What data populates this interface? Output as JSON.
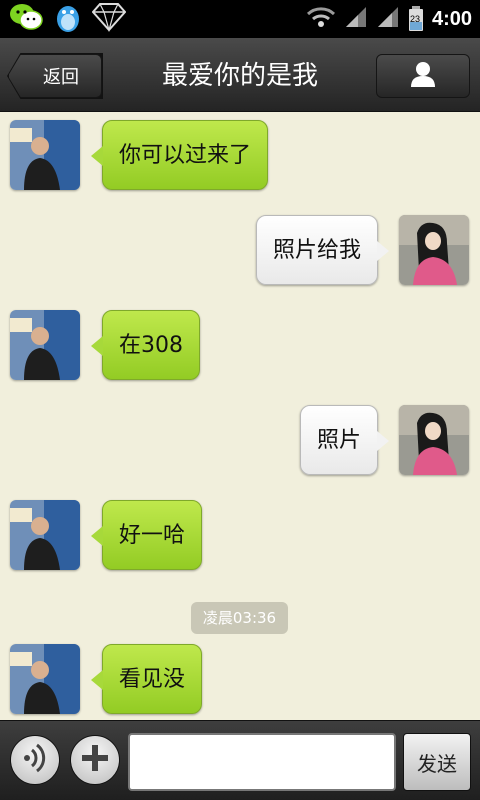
{
  "status_bar": {
    "time": "4:00",
    "battery_level": "23",
    "notification_icons": [
      "wechat-icon",
      "qq-penguin-icon",
      "diamond-icon"
    ],
    "system_icons": [
      "wifi-icon",
      "signal-icon",
      "signal-icon",
      "battery-icon"
    ]
  },
  "header": {
    "back_label": "返回",
    "title": "最爱你的是我",
    "profile_icon": "person-icon"
  },
  "messages": [
    {
      "side": "left",
      "text": "你可以过来了"
    },
    {
      "side": "right",
      "text": "照片给我"
    },
    {
      "side": "left",
      "text": "在308"
    },
    {
      "side": "right",
      "text": "照片"
    },
    {
      "side": "left",
      "text": "好一哈"
    },
    {
      "side": "left",
      "text": "看见没"
    }
  ],
  "timestamp": "凌晨03:36",
  "composer": {
    "voice_icon": "voice-icon",
    "add_icon": "plus-icon",
    "input_value": "",
    "send_label": "发送"
  },
  "colors": {
    "chat_background": "#f1efdc",
    "left_bubble": "#a7d93a",
    "right_bubble": "#ffffff",
    "bar_dark": "#2a2a2a"
  }
}
